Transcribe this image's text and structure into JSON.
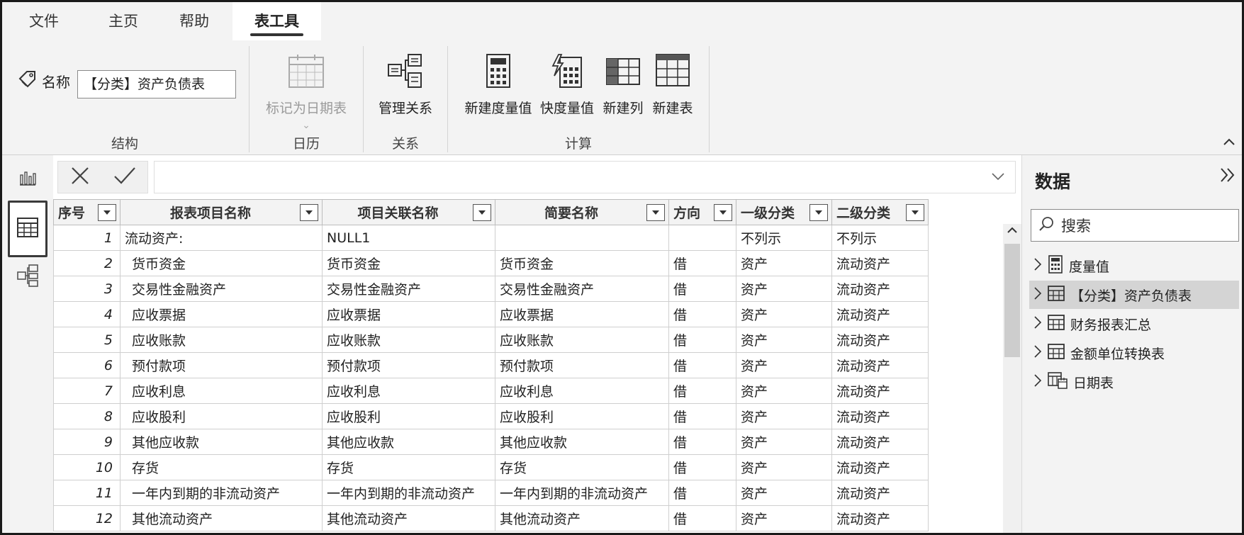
{
  "menu": {
    "tabs": [
      {
        "label": "文件"
      },
      {
        "label": "主页"
      },
      {
        "label": "帮助"
      },
      {
        "label": "表工具"
      }
    ]
  },
  "ribbon": {
    "name_label": "名称",
    "name_value": "【分类】资产负债表",
    "groups": {
      "structure": "结构",
      "calendar": "日历",
      "relations": "关系",
      "calc": "计算"
    },
    "buttons": {
      "mark_date_table": "标记为日期表",
      "manage_relations": "管理关系",
      "new_measure": "新建度量值",
      "quick_measure": "快度量值",
      "new_column": "新建列",
      "new_table": "新建表"
    }
  },
  "table": {
    "columns": [
      "序号",
      "报表项目名称",
      "项目关联名称",
      "简要名称",
      "方向",
      "一级分类",
      "二级分类"
    ],
    "rows": [
      [
        "1",
        "流动资产:",
        "NULL1",
        "",
        "",
        "不列示",
        "不列示"
      ],
      [
        "2",
        "货币资金",
        "货币资金",
        "货币资金",
        "借",
        "资产",
        "流动资产"
      ],
      [
        "3",
        "交易性金融资产",
        "交易性金融资产",
        "交易性金融资产",
        "借",
        "资产",
        "流动资产"
      ],
      [
        "4",
        "应收票据",
        "应收票据",
        "应收票据",
        "借",
        "资产",
        "流动资产"
      ],
      [
        "5",
        "应收账款",
        "应收账款",
        "应收账款",
        "借",
        "资产",
        "流动资产"
      ],
      [
        "6",
        "预付款项",
        "预付款项",
        "预付款项",
        "借",
        "资产",
        "流动资产"
      ],
      [
        "7",
        "应收利息",
        "应收利息",
        "应收利息",
        "借",
        "资产",
        "流动资产"
      ],
      [
        "8",
        "应收股利",
        "应收股利",
        "应收股利",
        "借",
        "资产",
        "流动资产"
      ],
      [
        "9",
        "其他应收款",
        "其他应收款",
        "其他应收款",
        "借",
        "资产",
        "流动资产"
      ],
      [
        "10",
        "存货",
        "存货",
        "存货",
        "借",
        "资产",
        "流动资产"
      ],
      [
        "11",
        "一年内到期的非流动资产",
        "一年内到期的非流动资产",
        "一年内到期的非流动资产",
        "借",
        "资产",
        "流动资产"
      ],
      [
        "12",
        "其他流动资产",
        "其他流动资产",
        "其他流动资产",
        "借",
        "资产",
        "流动资产"
      ]
    ]
  },
  "pane": {
    "title": "数据",
    "search_placeholder": "搜索",
    "items": [
      {
        "label": "度量值",
        "icon": "calculator-icon"
      },
      {
        "label": "【分类】资产负债表",
        "icon": "table-icon"
      },
      {
        "label": "财务报表汇总",
        "icon": "table-icon"
      },
      {
        "label": "金额单位转换表",
        "icon": "table-icon"
      },
      {
        "label": "日期表",
        "icon": "date-table-icon"
      }
    ]
  }
}
